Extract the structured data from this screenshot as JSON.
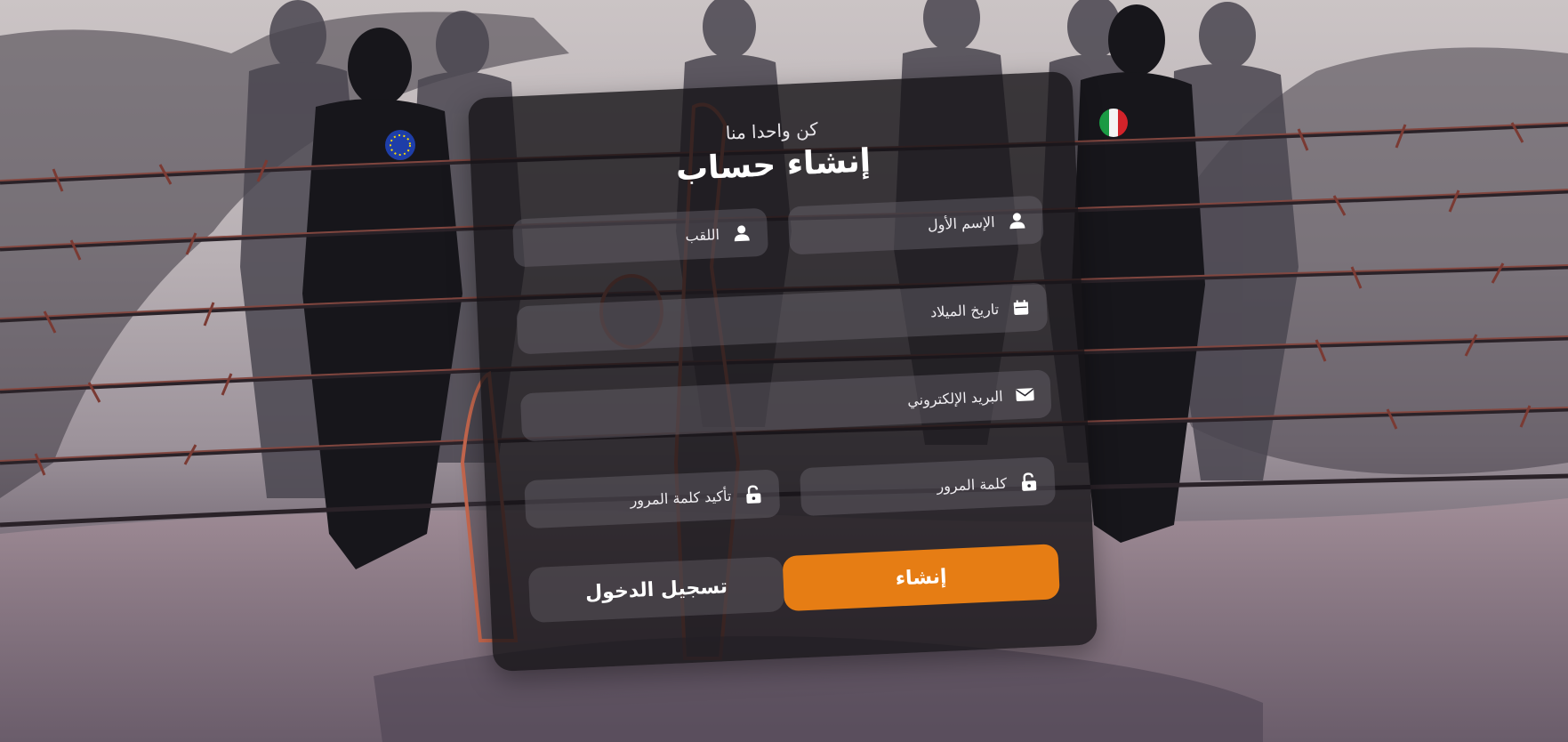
{
  "form": {
    "subtitle": "كن واحدا منا",
    "title": "إنشاء حساب",
    "fields": {
      "first_name": {
        "label": "الإسم الأول",
        "icon": "user-icon"
      },
      "last_name": {
        "label": "اللقب",
        "icon": "user-icon"
      },
      "birth_date": {
        "label": "تاريخ الميلاد",
        "icon": "calendar-icon"
      },
      "email": {
        "label": "البريد الإلكتروني",
        "icon": "envelope-icon"
      },
      "password": {
        "label": "كلمة المرور",
        "icon": "unlock-icon"
      },
      "confirm_password": {
        "label": "تأكيد كلمة المرور",
        "icon": "unlock-icon"
      }
    },
    "buttons": {
      "create": "إنشاء",
      "login": "تسجيل الدخول"
    }
  },
  "colors": {
    "accent": "#e67d14",
    "card": "#161418",
    "field": "#6e6a72"
  }
}
